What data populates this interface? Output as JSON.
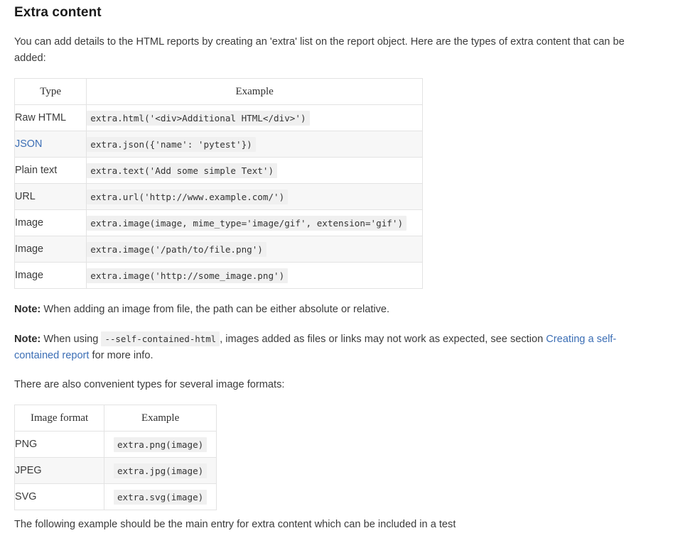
{
  "heading": "Extra content",
  "intro_paragraph": "You can add details to the HTML reports by creating an 'extra' list on the report object. Here are the types of extra content that can be added:",
  "extra_content_table": {
    "headers": [
      "Type",
      "Example"
    ],
    "rows": [
      {
        "type": "Raw HTML",
        "type_is_link": false,
        "example": "extra.html('<div>Additional HTML</div>')"
      },
      {
        "type": "JSON",
        "type_is_link": true,
        "example": "extra.json({'name': 'pytest'})"
      },
      {
        "type": "Plain text",
        "type_is_link": false,
        "example": "extra.text('Add some simple Text')"
      },
      {
        "type": "URL",
        "type_is_link": false,
        "example": "extra.url('http://www.example.com/')"
      },
      {
        "type": "Image",
        "type_is_link": false,
        "example": "extra.image(image, mime_type='image/gif', extension='gif')"
      },
      {
        "type": "Image",
        "type_is_link": false,
        "example": "extra.image('/path/to/file.png')"
      },
      {
        "type": "Image",
        "type_is_link": false,
        "example": "extra.image('http://some_image.png')"
      }
    ]
  },
  "note_one": {
    "label": "Note:",
    "text": " When adding an image from file, the path can be either absolute or relative."
  },
  "note_two": {
    "label": "Note:",
    "text_before": " When using ",
    "code": "--self-contained-html",
    "text_middle": ", images added as files or links may not work as expected, see section ",
    "link": "Creating a self-contained report",
    "text_after": " for more info."
  },
  "formats_intro": "There are also convenient types for several image formats:",
  "image_formats_table": {
    "headers": [
      "Image format",
      "Example"
    ],
    "rows": [
      {
        "format": "PNG",
        "example": "extra.png(image)"
      },
      {
        "format": "JPEG",
        "example": "extra.jpg(image)"
      },
      {
        "format": "SVG",
        "example": "extra.svg(image)"
      }
    ]
  },
  "clipped_bottom_text": "The following example should be the main entry for extra content which can be included in a test",
  "colors": {
    "link": "#3b6eb5",
    "heading": "#1a1a1a",
    "body_text": "#3b3b3b",
    "code_background": "#f0f0f0",
    "table_border": "#e3e3e3",
    "row_stripe": "#f7f7f7"
  }
}
